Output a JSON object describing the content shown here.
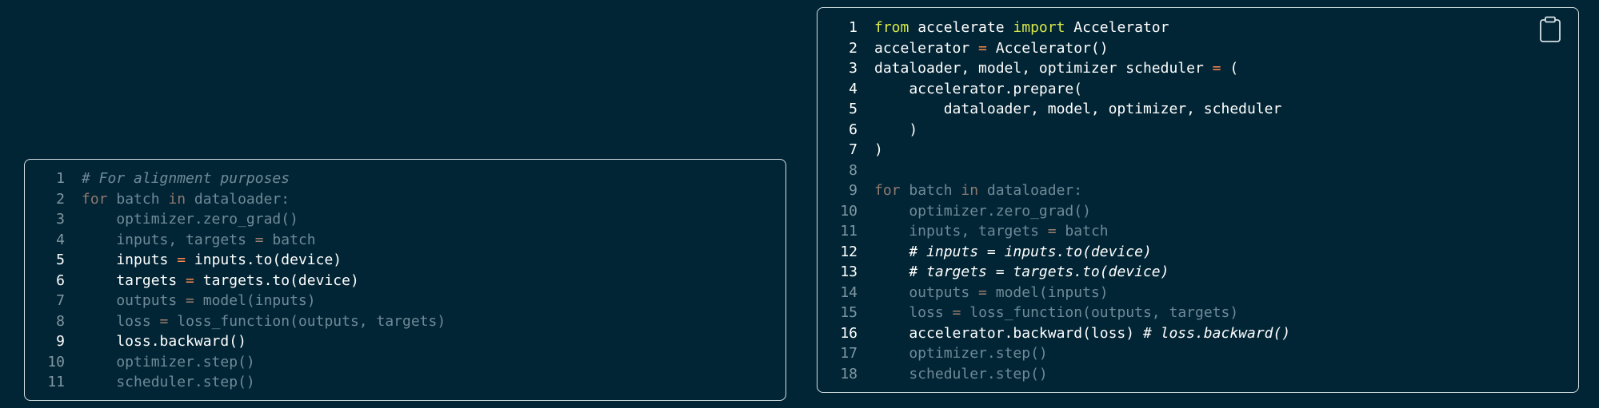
{
  "left_panel": {
    "lines": [
      {
        "n": "1",
        "hl": false,
        "t": [
          {
            "s": "# For alignment purposes",
            "c": "comment"
          }
        ]
      },
      {
        "n": "2",
        "hl": false,
        "t": [
          {
            "s": "for",
            "c": "kw"
          },
          {
            "s": " batch "
          },
          {
            "s": "in",
            "c": "kw"
          },
          {
            "s": " dataloader:"
          }
        ]
      },
      {
        "n": "3",
        "hl": false,
        "t": [
          {
            "s": "    optimizer.zero_grad()"
          }
        ]
      },
      {
        "n": "4",
        "hl": false,
        "t": [
          {
            "s": "    inputs, targets "
          },
          {
            "s": "=",
            "c": "op"
          },
          {
            "s": " batch"
          }
        ]
      },
      {
        "n": "5",
        "hl": true,
        "t": [
          {
            "s": "    inputs "
          },
          {
            "s": "=",
            "c": "op"
          },
          {
            "s": " inputs.to(device)"
          }
        ]
      },
      {
        "n": "6",
        "hl": true,
        "t": [
          {
            "s": "    targets "
          },
          {
            "s": "=",
            "c": "op"
          },
          {
            "s": " targets.to(device)"
          }
        ]
      },
      {
        "n": "7",
        "hl": false,
        "t": [
          {
            "s": "    outputs "
          },
          {
            "s": "=",
            "c": "op"
          },
          {
            "s": " model(inputs)"
          }
        ]
      },
      {
        "n": "8",
        "hl": false,
        "t": [
          {
            "s": "    loss "
          },
          {
            "s": "=",
            "c": "op"
          },
          {
            "s": " loss_function(outputs, targets)"
          }
        ]
      },
      {
        "n": "9",
        "hl": true,
        "t": [
          {
            "s": "    loss.backward()"
          }
        ]
      },
      {
        "n": "10",
        "hl": false,
        "t": [
          {
            "s": "    optimizer.step()"
          }
        ]
      },
      {
        "n": "11",
        "hl": false,
        "t": [
          {
            "s": "    scheduler.step()"
          }
        ]
      }
    ]
  },
  "right_panel": {
    "copy_icon": "clipboard-icon",
    "lines": [
      {
        "n": "1",
        "hl": true,
        "t": [
          {
            "s": "from",
            "c": "kw"
          },
          {
            "s": " accelerate "
          },
          {
            "s": "import",
            "c": "kw"
          },
          {
            "s": " Accelerator"
          }
        ]
      },
      {
        "n": "2",
        "hl": true,
        "t": [
          {
            "s": "accelerator "
          },
          {
            "s": "=",
            "c": "op"
          },
          {
            "s": " Accelerator()"
          }
        ]
      },
      {
        "n": "3",
        "hl": true,
        "t": [
          {
            "s": "dataloader, model, optimizer scheduler "
          },
          {
            "s": "=",
            "c": "op"
          },
          {
            "s": " ("
          }
        ]
      },
      {
        "n": "4",
        "hl": true,
        "t": [
          {
            "s": "    accelerator.prepare("
          }
        ]
      },
      {
        "n": "5",
        "hl": true,
        "t": [
          {
            "s": "        dataloader, model, optimizer, scheduler"
          }
        ]
      },
      {
        "n": "6",
        "hl": true,
        "t": [
          {
            "s": "    )"
          }
        ]
      },
      {
        "n": "7",
        "hl": true,
        "t": [
          {
            "s": ")"
          }
        ]
      },
      {
        "n": "8",
        "hl": false,
        "t": []
      },
      {
        "n": "9",
        "hl": false,
        "t": [
          {
            "s": "for",
            "c": "kw"
          },
          {
            "s": " batch "
          },
          {
            "s": "in",
            "c": "kw"
          },
          {
            "s": " dataloader:"
          }
        ]
      },
      {
        "n": "10",
        "hl": false,
        "t": [
          {
            "s": "    optimizer.zero_grad()"
          }
        ]
      },
      {
        "n": "11",
        "hl": false,
        "t": [
          {
            "s": "    inputs, targets "
          },
          {
            "s": "=",
            "c": "op"
          },
          {
            "s": " batch"
          }
        ]
      },
      {
        "n": "12",
        "hl": true,
        "t": [
          {
            "s": "    "
          },
          {
            "s": "# inputs = inputs.to(device)",
            "c": "comment"
          }
        ]
      },
      {
        "n": "13",
        "hl": true,
        "t": [
          {
            "s": "    "
          },
          {
            "s": "# targets = targets.to(device)",
            "c": "comment"
          }
        ]
      },
      {
        "n": "14",
        "hl": false,
        "t": [
          {
            "s": "    outputs "
          },
          {
            "s": "=",
            "c": "op"
          },
          {
            "s": " model(inputs)"
          }
        ]
      },
      {
        "n": "15",
        "hl": false,
        "t": [
          {
            "s": "    loss "
          },
          {
            "s": "=",
            "c": "op"
          },
          {
            "s": " loss_function(outputs, targets)"
          }
        ]
      },
      {
        "n": "16",
        "hl": true,
        "t": [
          {
            "s": "    accelerator.backward(loss) "
          },
          {
            "s": "# loss.backward()",
            "c": "comment"
          }
        ]
      },
      {
        "n": "17",
        "hl": false,
        "t": [
          {
            "s": "    optimizer.step()"
          }
        ]
      },
      {
        "n": "18",
        "hl": false,
        "t": [
          {
            "s": "    scheduler.step()"
          }
        ]
      }
    ]
  }
}
